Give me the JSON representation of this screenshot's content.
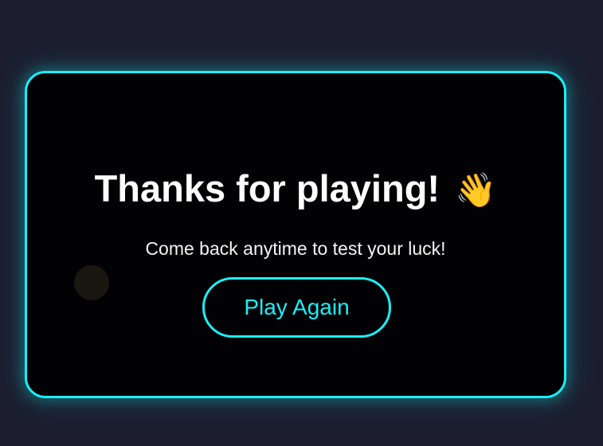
{
  "end_screen": {
    "title": "Thanks for playing!",
    "title_emoji": "👋",
    "subtitle": "Come back anytime to test your luck!",
    "play_again_label": "Play Again"
  },
  "colors": {
    "background": "#1b1d2e",
    "card_background": "#020205",
    "accent": "#19eff6",
    "text": "#ffffff"
  }
}
